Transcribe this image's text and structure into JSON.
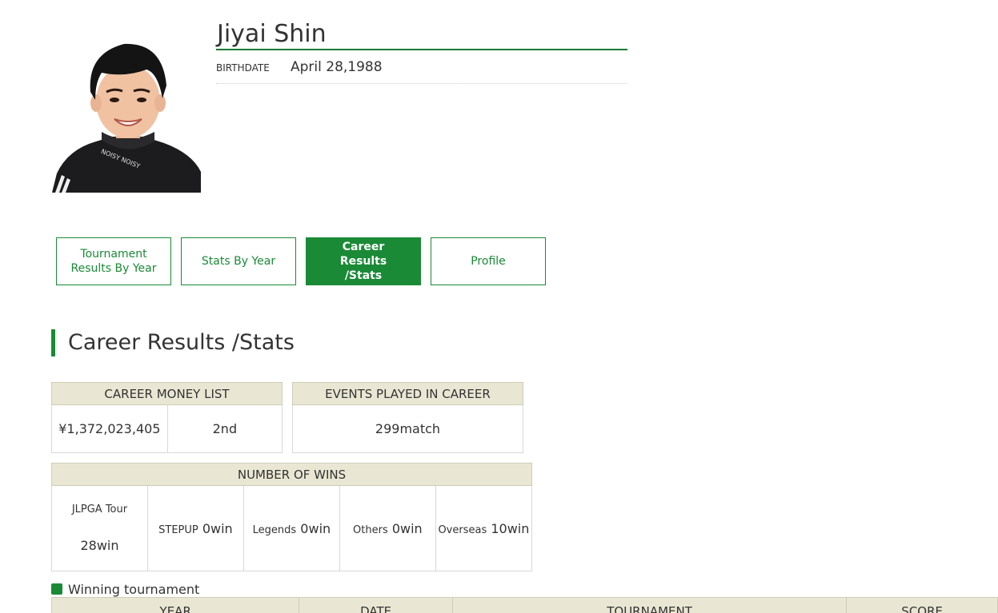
{
  "player": {
    "name": "Jiyai Shin",
    "birthdate_label": "BIRTHDATE",
    "birthdate": "April 28,1988"
  },
  "tabs": [
    {
      "line1": "Tournament",
      "line2": "Results By Year",
      "active": false
    },
    {
      "line1": "Stats By Year",
      "line2": "",
      "active": false
    },
    {
      "line1": "Career Results",
      "line2": "/Stats",
      "active": true
    },
    {
      "line1": "Profile",
      "line2": "",
      "active": false
    }
  ],
  "section_title": "Career Results /Stats",
  "career_money": {
    "header": "CAREER MONEY LIST",
    "amount": "¥1,372,023,405",
    "rank": "2nd"
  },
  "events_played": {
    "header": "EVENTS PLAYED IN CAREER",
    "value": "299match"
  },
  "wins": {
    "header": "NUMBER OF WINS",
    "jlpga_label": "JLPGA Tour",
    "jlpga_value": "28win",
    "stepup_label": "STEPUP",
    "stepup_value": "0win",
    "legends_label": "Legends",
    "legends_value": "0win",
    "others_label": "Others",
    "others_value": "0win",
    "overseas_label": "Overseas",
    "overseas_value": "10win"
  },
  "winning_legend": "Winning tournament",
  "winning_table": {
    "headers": [
      "YEAR",
      "DATE",
      "TOURNAMENT",
      "SCORE"
    ]
  },
  "colors": {
    "accent_green": "#1a8a36",
    "header_beige": "#e9e7d3"
  }
}
